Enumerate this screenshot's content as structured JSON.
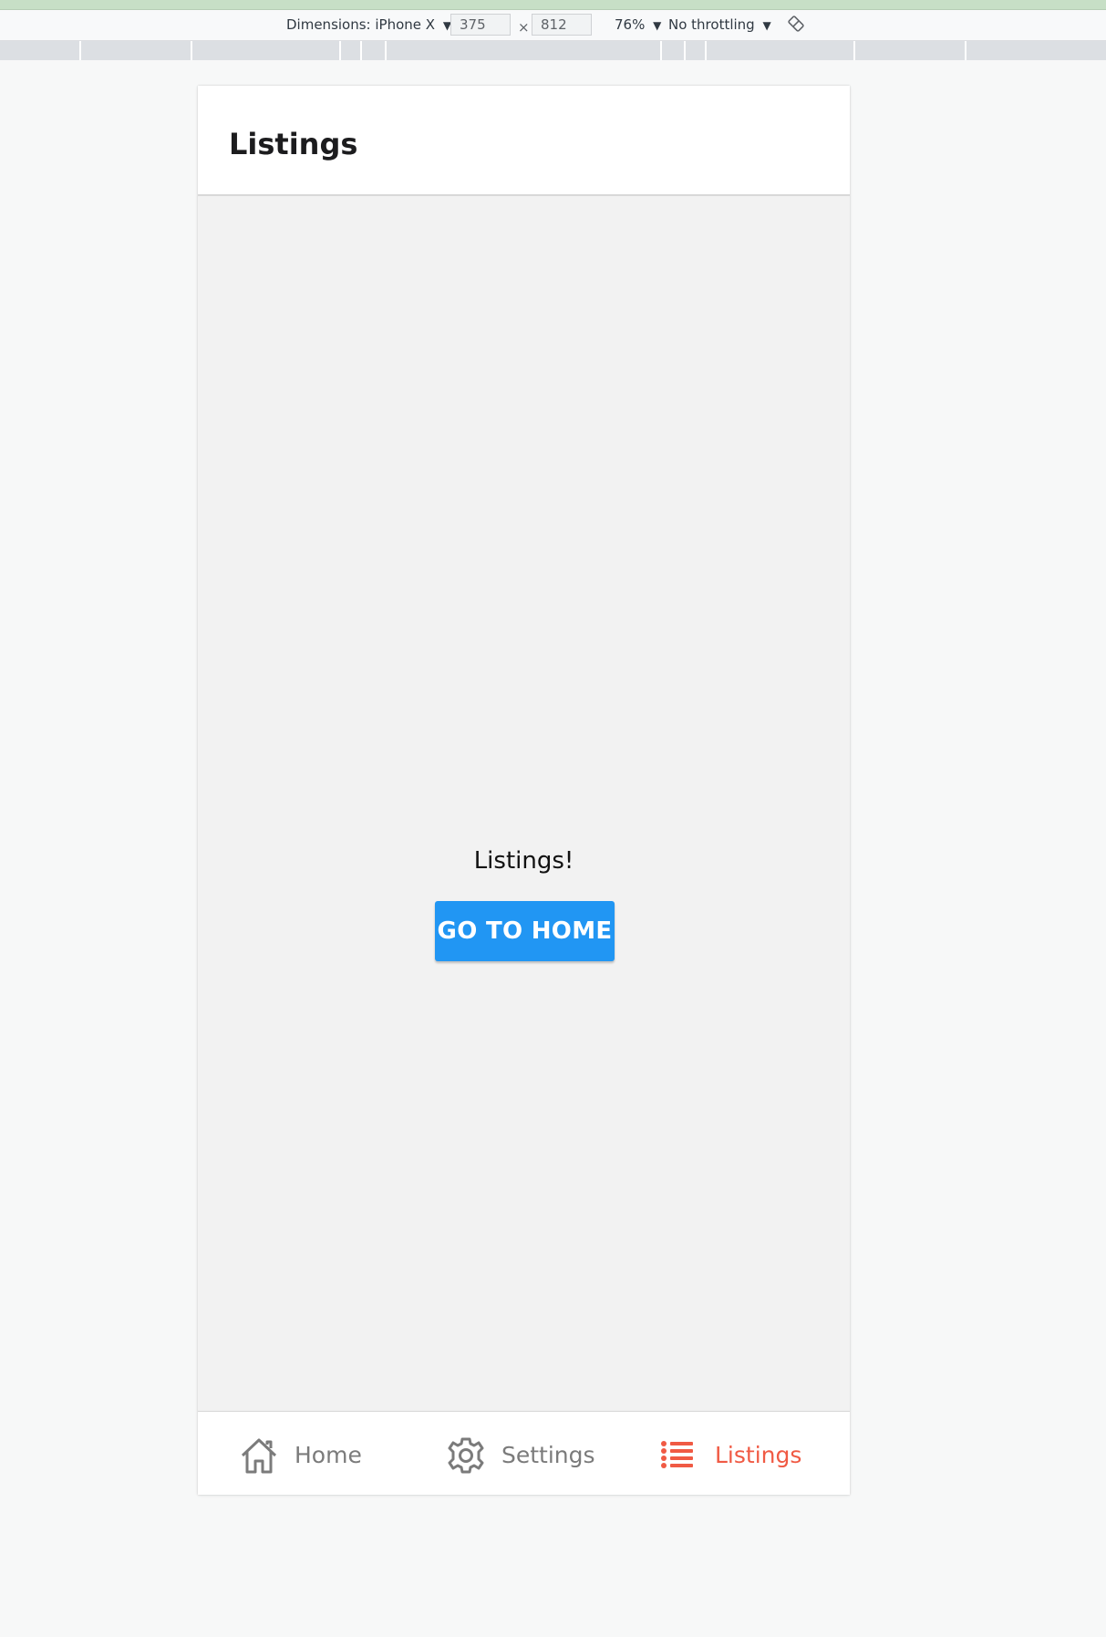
{
  "devtools": {
    "dimensions_label": "Dimensions: iPhone X",
    "dropdown_arrow": "▼",
    "width_value": "375",
    "height_value": "812",
    "times": "×",
    "zoom": "76%",
    "throttling": "No throttling",
    "rotate_icon": "rotate-icon"
  },
  "header": {
    "title": "Listings"
  },
  "main": {
    "text": "Listings!",
    "button_label": "GO TO HOME"
  },
  "tabs": [
    {
      "label": "Home",
      "icon": "home-icon",
      "active": false
    },
    {
      "label": "Settings",
      "icon": "gear-icon",
      "active": false
    },
    {
      "label": "Listings",
      "icon": "list-icon",
      "active": true
    }
  ],
  "colors": {
    "accent_active": "#f05a44",
    "inactive": "#7b7b7b",
    "button_blue": "#2196f3"
  }
}
